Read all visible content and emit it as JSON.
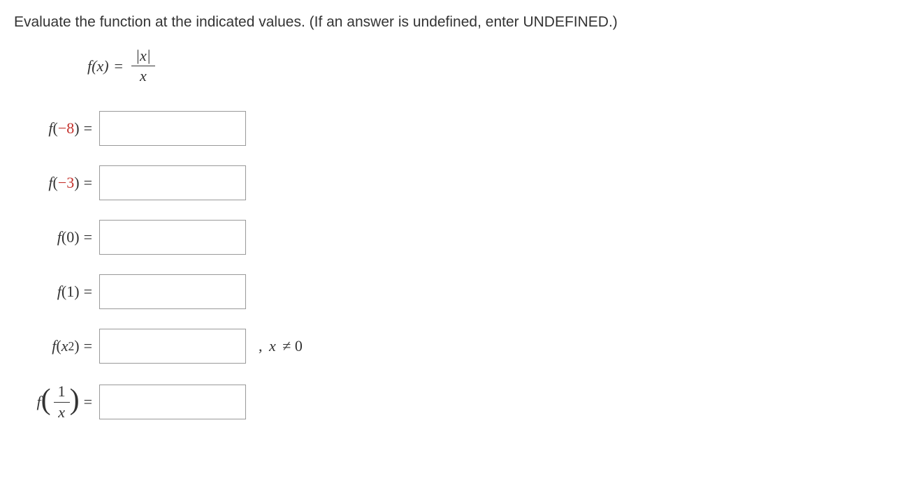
{
  "instruction": "Evaluate the function at the indicated values. (If an answer is undefined, enter UNDEFINED.)",
  "func": {
    "name_html": "f(x)",
    "eq": "=",
    "num": "|x|",
    "den": "x"
  },
  "rows": [
    {
      "f": "f",
      "open": "(",
      "neg": "−8",
      "close": ")",
      "eq": "=",
      "tail": ""
    },
    {
      "f": "f",
      "open": "(",
      "neg": "−3",
      "close": ")",
      "eq": "=",
      "tail": ""
    },
    {
      "f": "f",
      "open": "(",
      "val": "0",
      "close": ")",
      "eq": "=",
      "tail": ""
    },
    {
      "f": "f",
      "open": "(",
      "val": "1",
      "close": ")",
      "eq": "=",
      "tail": ""
    },
    {
      "f": "f",
      "open": "(",
      "xsq_base": "x",
      "xsq_sup": "2",
      "close": ")",
      "eq": "=",
      "tail_comma": ",",
      "tail_x": "x",
      "tail_ne": "≠",
      "tail_zero": "0"
    },
    {
      "f": "f",
      "frac_num": "1",
      "frac_den": "x",
      "eq": "=",
      "tail": ""
    }
  ]
}
